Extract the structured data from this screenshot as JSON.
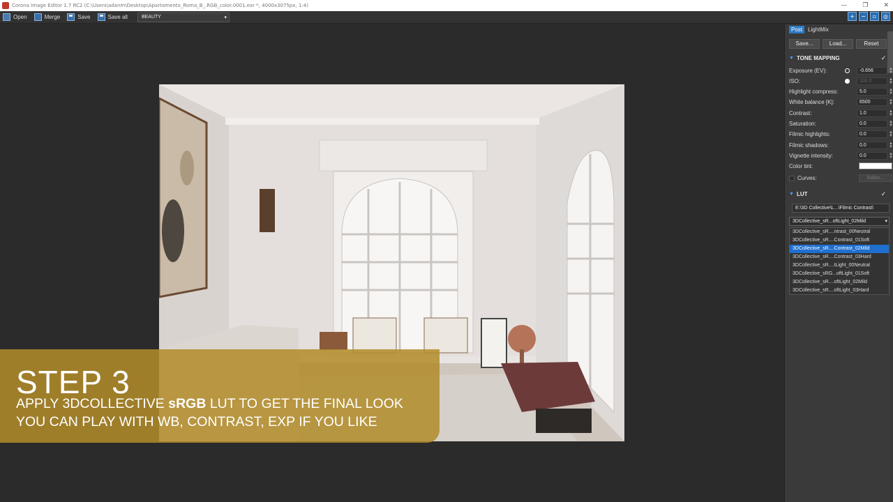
{
  "window": {
    "title": "Corona Image Editor 1.7 RC2 (C:\\Users\\adanm\\Desktop\\Apartamento_Roma_B_.RGB_color.0001.exr *, 4000x3075px, 1:4)",
    "controls": [
      "—",
      "❐",
      "✕"
    ]
  },
  "toolbar": {
    "open": "Open",
    "merge": "Merge",
    "save": "Save",
    "save_all": "Save all",
    "pass": "BEAUTY"
  },
  "overlay": {
    "step": "STEP 3",
    "line1_pre": "APPLY 3DCOLLECTIVE ",
    "line1_bold": "sRGB",
    "line1_post": " LUT TO GET THE FINAL LOOK",
    "line2": "YOU CAN PLAY WITH WB, CONTRAST, EXP IF YOU LIKE",
    "color": "#b28c2a"
  },
  "panel": {
    "tabs": [
      "Post",
      "LightMix"
    ],
    "buttons": {
      "save": "Save...",
      "load": "Load...",
      "reset": "Reset"
    },
    "tone_mapping": {
      "title": "TONE MAPPING",
      "rows": [
        {
          "label": "Exposure (EV):",
          "value": "-0.656"
        },
        {
          "label": "ISO:",
          "value": "100.0"
        },
        {
          "label": "Highlight compress:",
          "value": "5.0"
        },
        {
          "label": "White balance [K]:",
          "value": "6500"
        },
        {
          "label": "Contrast:",
          "value": "1.0"
        },
        {
          "label": "Saturation:",
          "value": "0.0"
        },
        {
          "label": "Filmic highlights:",
          "value": "0.0"
        },
        {
          "label": "Filmic shadows:",
          "value": "0.0"
        },
        {
          "label": "Vignette intensity:",
          "value": "0.0"
        }
      ],
      "color_tint": "Color tint:",
      "curves": "Curves:",
      "editor": "Editor..."
    },
    "lut": {
      "title": "LUT",
      "path": "E:\\3D Collective\\L...\\Filmic Contrast\\",
      "selected": "3DCollective_sR...oftLight_02Mild",
      "options": [
        "3DCollective_sR....ntrast_00Neutral",
        "3DCollective_sR....Contrast_01Soft",
        "3DCollective_sR....Contrast_02Mild",
        "3DCollective_sR....Contrast_03Hard",
        "3DCollective_sR....tLight_00Neutral",
        "3DCollective_sRG...oftLight_01Soft",
        "3DCollective_sR....oftLight_02Mild",
        "3DCollective_sR....oftLight_03Hard"
      ],
      "highlighted_index": 2
    }
  }
}
